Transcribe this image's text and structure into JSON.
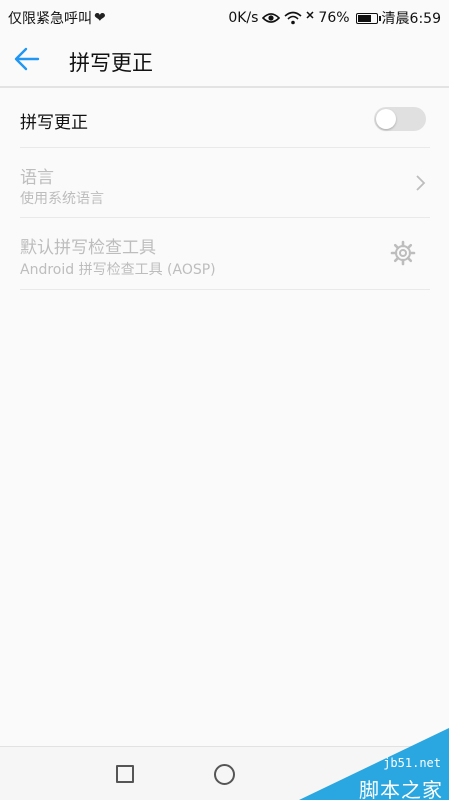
{
  "status_bar": {
    "left_text": "仅限紧急呼叫",
    "speed": "0K/s",
    "battery": "76%",
    "battery_level": 0.76,
    "time": "清晨6:59"
  },
  "app_bar": {
    "title": "拼写更正"
  },
  "settings": {
    "spell_check": {
      "label": "拼写更正",
      "enabled": false
    },
    "language": {
      "label": "语言",
      "value": "使用系统语言"
    },
    "default_checker": {
      "label": "默认拼写检查工具",
      "value": "Android 拼写检查工具 (AOSP)"
    }
  },
  "colors": {
    "accent": "#2196f3",
    "disabled_text": "#bdbdbd",
    "toggle_off": "#e0e0e0",
    "watermark": "#2aa7e0"
  },
  "watermark": {
    "url": "jb51.net",
    "name": "脚本之家"
  }
}
